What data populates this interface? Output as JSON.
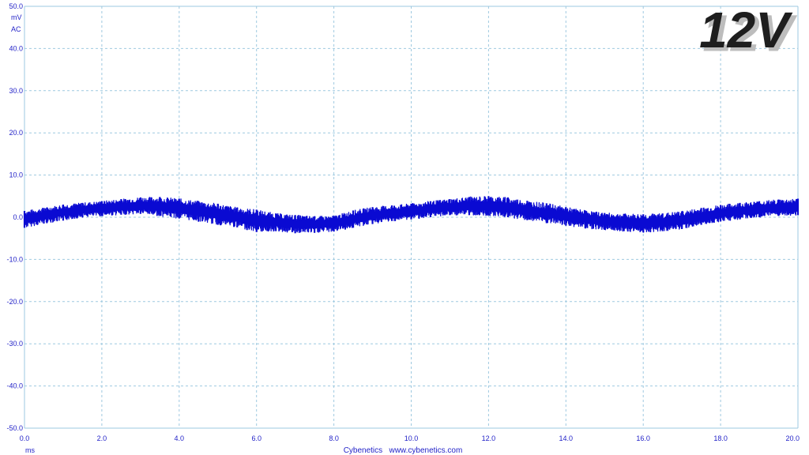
{
  "badge": {
    "label": "12V"
  },
  "chart_data": {
    "type": "line",
    "title": "",
    "xlabel": "ms",
    "ylabel": "mV",
    "coupling": "AC",
    "footer": "Cybenetics   www.cybenetics.com",
    "xlim": [
      0,
      20
    ],
    "ylim": [
      -50,
      50
    ],
    "x_ticks": [
      "0.0",
      "2.0",
      "4.0",
      "6.0",
      "8.0",
      "10.0",
      "12.0",
      "14.0",
      "16.0",
      "18.0",
      "20.0"
    ],
    "y_ticks": [
      "50.0",
      "40.0",
      "30.0",
      "20.0",
      "10.0",
      "0.0",
      "-10.0",
      "-20.0",
      "-30.0",
      "-40.0",
      "-50.0"
    ],
    "grid": true,
    "colors": {
      "trace": "#0a0ad2",
      "grid": "#9ec9e0",
      "text": "#2323c8"
    },
    "series": [
      {
        "x": [
          0,
          0.5,
          1,
          1.5,
          2,
          2.5,
          3,
          3.5,
          4,
          4.5,
          5,
          5.5,
          6,
          6.5,
          7,
          7.5,
          8,
          8.5,
          9,
          9.5,
          10,
          10.5,
          11,
          11.5,
          12,
          12.5,
          13,
          13.5,
          14,
          14.5,
          15,
          15.5,
          16,
          16.5,
          17,
          17.5,
          18,
          18.5,
          19,
          19.5,
          20
        ],
        "center": [
          -0.5,
          0.5,
          1.2,
          1.8,
          2.1,
          2.5,
          2.8,
          2.6,
          2.2,
          1.6,
          0.8,
          0,
          -0.7,
          -1.2,
          -1.5,
          -1.6,
          -1.4,
          -0.4,
          0.4,
          0.9,
          1.4,
          1.9,
          2.4,
          2.6,
          2.6,
          2.2,
          1.5,
          0.9,
          0.3,
          -0.3,
          -0.8,
          -1.2,
          -1.4,
          -1.2,
          -0.6,
          0.1,
          0.8,
          1.4,
          1.9,
          2.2,
          2.5
        ],
        "min": [
          -2.5,
          -1.5,
          -0.8,
          0,
          0.3,
          0.6,
          0.8,
          0.3,
          -0.3,
          -1,
          -1.8,
          -2.4,
          -3.5,
          -3.3,
          -3.8,
          -3.7,
          -3.4,
          -2.5,
          -1.6,
          -0.9,
          -0.5,
          0,
          0.5,
          0.5,
          0.4,
          0,
          -0.7,
          -1.4,
          -2,
          -2.6,
          -3,
          -3.3,
          -3.6,
          -3.3,
          -2.8,
          -1.8,
          -1,
          -0.5,
          0,
          0.3,
          0.5
        ],
        "max": [
          1.5,
          2.2,
          3,
          3.4,
          3.8,
          4.3,
          4.7,
          4.8,
          4.4,
          3.8,
          3.2,
          2.3,
          1.8,
          0.9,
          0.5,
          0.2,
          0.3,
          1.6,
          2.4,
          2.8,
          3.2,
          3.8,
          4.3,
          4.8,
          5,
          4.7,
          3.9,
          3.3,
          2.4,
          1.6,
          1,
          0.8,
          0.7,
          0.9,
          1.4,
          2.2,
          2.9,
          3.4,
          3.8,
          4.2,
          4.4
        ]
      }
    ]
  }
}
